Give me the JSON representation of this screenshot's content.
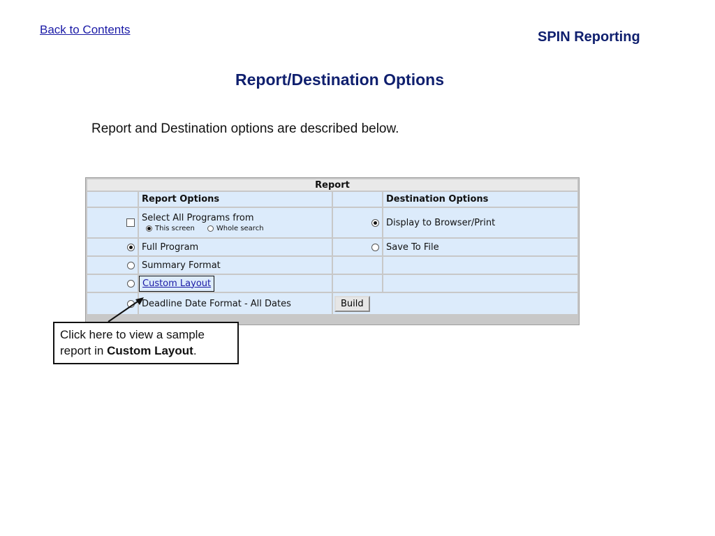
{
  "nav": {
    "back_link": "Back to Contents"
  },
  "brand": "SPIN Reporting",
  "title": "Report/Destination Options",
  "intro": "Report and Destination options are described below.",
  "report": {
    "header": "Report",
    "report_options_label": "Report Options",
    "destination_options_label": "Destination Options",
    "select_all_label": "Select All Programs from",
    "this_screen": "This screen",
    "whole_search": "Whole search",
    "display_label": "Display to Browser/Print",
    "full_program": "Full Program",
    "save_to_file": "Save To File",
    "summary_format": "Summary Format",
    "custom_layout": "Custom Layout",
    "deadline_format": "Deadline Date Format - All Dates",
    "build_button": "Build"
  },
  "callout": {
    "text_before": "Click here to view a sample report in ",
    "text_bold": "Custom Layout",
    "text_after": "."
  }
}
